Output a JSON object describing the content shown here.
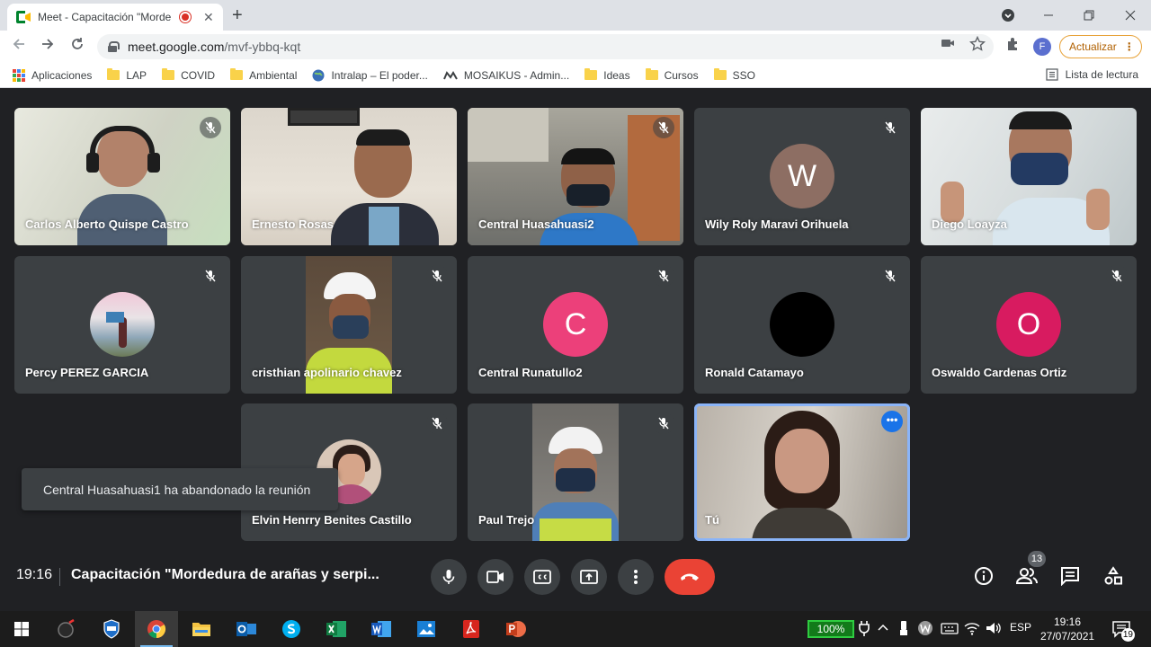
{
  "browser": {
    "tab_title": "Meet - Capacitación \"Morde",
    "tab_close": "✕",
    "new_tab": "+",
    "url_host": "meet.google.com",
    "url_path": "/mvf-ybbq-kqt",
    "profile_initial": "F",
    "update_label": "Actualizar",
    "update_dots": "⋮",
    "bookmarks": [
      {
        "label": "Aplicaciones",
        "icon": "apps-icon"
      },
      {
        "label": "LAP",
        "icon": "folder-icon"
      },
      {
        "label": "COVID",
        "icon": "folder-icon"
      },
      {
        "label": "Ambiental",
        "icon": "folder-icon"
      },
      {
        "label": "Intralap – El poder...",
        "icon": "globe-icon"
      },
      {
        "label": "MOSAIKUS - Admin...",
        "icon": "mosaikus-icon"
      },
      {
        "label": "Ideas",
        "icon": "folder-icon"
      },
      {
        "label": "Cursos",
        "icon": "folder-icon"
      },
      {
        "label": "SSO",
        "icon": "folder-icon"
      }
    ],
    "reading_list": "Lista de lectura"
  },
  "participants": [
    {
      "name": "Carlos Alberto Quispe Castro"
    },
    {
      "name": "Ernesto Rosas"
    },
    {
      "name": "Central Huasahuasi2"
    },
    {
      "name": "Wily Roly Maravi Orihuela",
      "initial": "W",
      "color": "#8d6e63"
    },
    {
      "name": "Diego Loayza"
    },
    {
      "name": "Percy PEREZ GARCIA"
    },
    {
      "name": "cristhian apolinario chavez"
    },
    {
      "name": "Central Runatullo2",
      "initial": "C",
      "color": "#ec407a"
    },
    {
      "name": "Ronald Catamayo",
      "color": "#000000"
    },
    {
      "name": "Oswaldo Cardenas Ortiz",
      "initial": "O",
      "color": "#d81b60"
    },
    {
      "name": "Elvin Henrry Benites Castillo"
    },
    {
      "name": "Paul Trejo"
    },
    {
      "name": "Tú",
      "more": "•••"
    }
  ],
  "toast": "Central Huasahuasi1 ha abandonado la reunión",
  "meeting": {
    "time": "19:16",
    "title": "Capacitación \"Mordedura de arañas y serpi...",
    "participant_count": "13"
  },
  "taskbar": {
    "battery": "100%",
    "lang": "ESP",
    "time": "19:16",
    "date": "27/07/2021",
    "notifications": "19"
  },
  "colors": {
    "meet_bg": "#202124",
    "tile_bg": "#3c4043",
    "end_call": "#ea4335",
    "self_border": "#8ab4f8"
  }
}
